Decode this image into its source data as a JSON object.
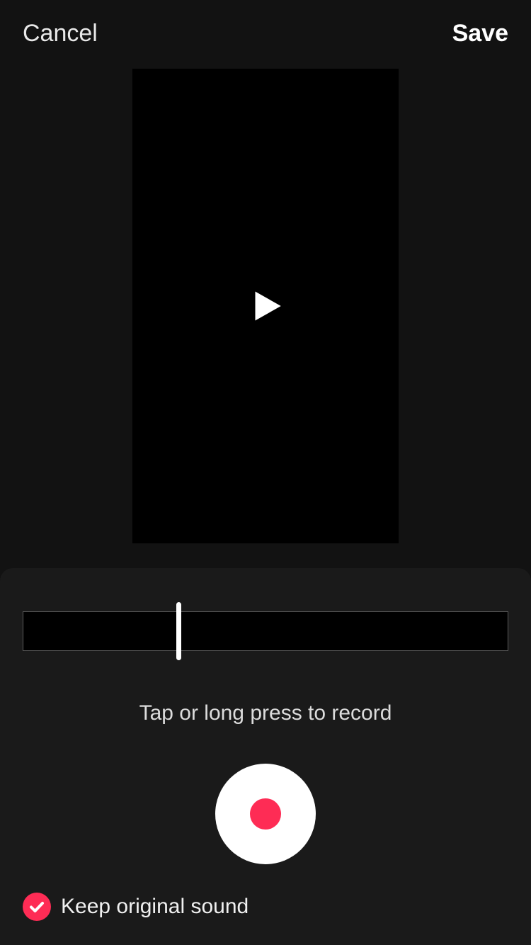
{
  "header": {
    "cancel_label": "Cancel",
    "save_label": "Save"
  },
  "recording": {
    "hint": "Tap or long press to record"
  },
  "options": {
    "keep_original_sound_label": "Keep original sound",
    "keep_original_sound_checked": true
  },
  "colors": {
    "accent": "#fe2c55"
  }
}
